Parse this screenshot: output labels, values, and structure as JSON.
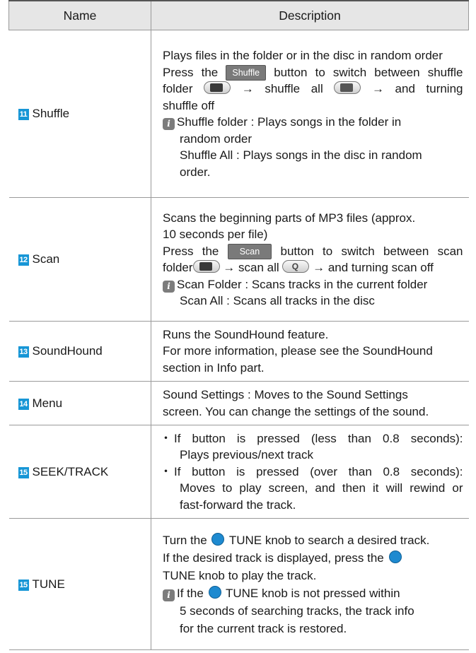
{
  "header": {
    "name": "Name",
    "description": "Description"
  },
  "rows": {
    "shuffle": {
      "num": "11",
      "name": "Shuffle",
      "l1": "Plays files in the folder or in the disc in random order",
      "l2a": "Press the",
      "btn": "Shuffle",
      "l2b": "button to switch between shuffle",
      "l3a": "folder",
      "l3b": "→ shuffle all",
      "l3c": "→ and turning",
      "l4": "shuffle off",
      "n1": "Shuffle folder : Plays songs in the folder in",
      "n2": "random order",
      "n3": "Shuffle All : Plays songs in the disc in random",
      "n4": "order."
    },
    "scan": {
      "num": "12",
      "name": "Scan",
      "l1": "Scans the beginning parts of MP3 files (approx.",
      "l2": "10 seconds per file)",
      "l3a": "Press the",
      "btn": "Scan",
      "l3b": "button to switch between scan",
      "l4a": "folder",
      "l4b": "→ scan all",
      "l4c": "→ and turning scan off",
      "n1": "Scan Folder : Scans tracks in the current folder",
      "n2": "Scan All : Scans all tracks in the disc"
    },
    "soundhound": {
      "num": "13",
      "name": "SoundHound",
      "l1": "Runs the SoundHound feature.",
      "l2": "For more information, please see the SoundHound",
      "l3": "section in Info part."
    },
    "menu": {
      "num": "14",
      "name": "Menu",
      "l1": "Sound Settings : Moves to the Sound Settings",
      "l2": "screen. You can change the settings of the sound."
    },
    "seek": {
      "num": "15",
      "name": "SEEK/TRACK",
      "b1a": "If button is pressed (less than 0.8 seconds):",
      "b1b": "Plays previous/next track",
      "b2a": "If button is pressed (over than 0.8 seconds):",
      "b2b": "Moves to play screen, and then it will rewind or",
      "b2c": "fast-forward the track."
    },
    "tune": {
      "num": "15",
      "name": "TUNE",
      "l1a": "Turn the",
      "l1b": "TUNE knob to search a desired track.",
      "l2a": "If the desired track is displayed, press the",
      "l3": "TUNE knob to play the track.",
      "n1a": "If the",
      "n1b": "TUNE knob is not pressed within",
      "n2": "5 seconds of searching tracks, the track info",
      "n3": "for the current track is restored."
    }
  },
  "icons": {
    "info": "i",
    "scan_all_glyph": "Q"
  },
  "colors": {
    "number_badge": "#1796d6",
    "knob": "#1e8ad0",
    "header_bg": "#e6e6e6"
  }
}
